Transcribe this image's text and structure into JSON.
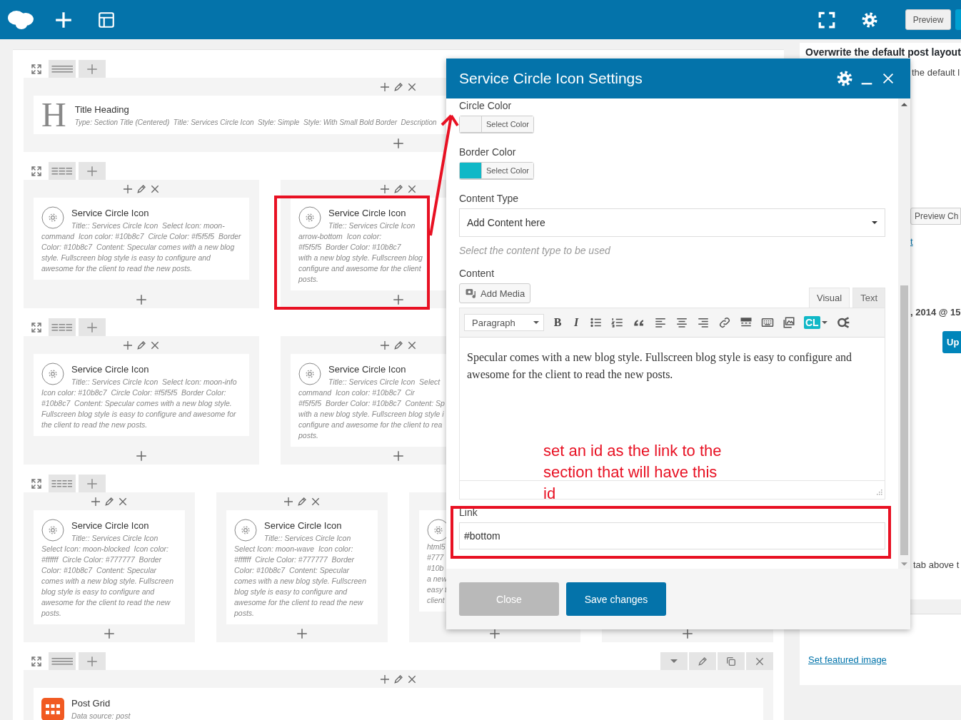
{
  "top_bar": {
    "preview_button": "Preview"
  },
  "builder": {
    "rows": [
      {
        "kind": "full",
        "columns": [
          {
            "elements": [
              {
                "kind": "heading",
                "icon_letter": "H",
                "title": "Title Heading",
                "description": "Type: Section Title (Centered)  Title: Services Circle Icon  Style: Simple  Style: With Small Bold Border  Description"
              }
            ]
          }
        ]
      },
      {
        "kind": "thirds",
        "columns": [
          {
            "elements": [
              {
                "kind": "service",
                "title": "Service Circle Icon",
                "description": "Title:: Services Circle Icon  Select Icon: moon-command  Icon color: #10b8c7  Circle Color: #f5f5f5  Border Color: #10b8c7  Content: Specular comes with a new blog style. Fullscreen blog style is easy to configure and awesome for the client to read the new posts."
              }
            ]
          },
          {
            "elements": [
              {
                "kind": "service",
                "title": "Service Circle Icon",
                "description": "Title:: Services Circle Icon\narrow-bottom  Icon color:\n#f5f5f5  Border Color: #10b8c7\nwith a new blog style. Fullscreen blog\nconfigure and awesome for the client\nposts."
              }
            ]
          }
        ]
      },
      {
        "kind": "thirds",
        "columns": [
          {
            "elements": [
              {
                "kind": "service",
                "title": "Service Circle Icon",
                "description": "Title:: Services Circle Icon  Select Icon: moon-info  Icon color: #10b8c7  Circle Color: #f5f5f5  Border Color: #10b8c7  Content: Specular comes with a new blog style. Fullscreen blog style is easy to configure and awesome for the client to read the new posts."
              }
            ]
          },
          {
            "elements": [
              {
                "kind": "service",
                "title": "Service Circle Icon",
                "description": "Title:: Services Circle Icon  Select\ncommand  Icon color: #10b8c7  Cir\n#f5f5f5  Border Color: #10b8c7  Content: Sp\nwith a new blog style. Fullscreen blog style i\nconfigure and awesome for the client to rea\nposts."
              }
            ]
          }
        ]
      },
      {
        "kind": "quarters",
        "columns": [
          {
            "elements": [
              {
                "kind": "service",
                "title": "Service Circle Icon",
                "description": "Title:: Services Circle Icon  Select Icon: moon-blocked  Icon color: #ffffff  Circle Color: #777777  Border Color: #10b8c7  Content: Specular comes with a new blog style. Fullscreen blog style is easy to configure and awesome for the client to read the new posts."
              }
            ]
          },
          {
            "elements": [
              {
                "kind": "service",
                "title": "Service Circle Icon",
                "description": "Title:: Services Circle Icon  Select Icon: moon-wave  Icon color: #ffffff  Circle Color: #777777  Border Color: #10b8c7  Content: Specular comes with a new blog style. Fullscreen blog style is easy to configure and awesome for the client to read the new posts."
              }
            ]
          },
          {
            "elements": [
              {
                "kind": "service",
                "description": "html5\n#777\n#10b\na new\neasy t\nclient"
              }
            ]
          },
          {}
        ]
      },
      {
        "kind": "full",
        "columns": [
          {
            "elements": [
              {
                "kind": "grid",
                "title": "Post Grid",
                "description": "Data source: post"
              }
            ]
          }
        ]
      }
    ]
  },
  "sidebar": {
    "items": [
      {
        "kind": "heading",
        "text": "Overwrite the default post layout"
      },
      {
        "kind": "text",
        "text": "the default l"
      },
      {
        "kind": "button",
        "text": "Preview Ch"
      },
      {
        "kind": "link",
        "text": "t"
      },
      {
        "kind": "meta",
        "text": ", 2014 @ 15"
      },
      {
        "kind": "primary",
        "text": "Up"
      },
      {
        "kind": "text",
        "text": "tab above t"
      }
    ],
    "featured_link": "Set featured image"
  },
  "modal": {
    "title": "Service Circle Icon Settings",
    "fields": [
      {
        "kind": "color",
        "label": "Circle Color",
        "color": "#f5f5f5",
        "button": "Select Color"
      },
      {
        "kind": "color",
        "label": "Border Color",
        "color": "#10b8c7",
        "button": "Select Color"
      },
      {
        "kind": "select",
        "label": "Content Type",
        "value": "Add Content here",
        "help": "Select the content type to be used"
      },
      {
        "kind": "editor",
        "label": "Content",
        "media_button": "Add Media",
        "tabs": [
          {
            "label": "Visual",
            "selected": true
          },
          {
            "label": "Text",
            "selected": false
          }
        ],
        "format": "Paragraph",
        "bold": "B",
        "italic": "I",
        "plugin": "CL",
        "text": "Specular comes with a new blog style. Fullscreen blog style is easy to configure and awesome for the client to read the new posts."
      },
      {
        "kind": "text",
        "label": "Link",
        "value": "#bottom"
      }
    ],
    "buttons": [
      {
        "label": "Close",
        "kind": "secondary"
      },
      {
        "label": "Save changes",
        "kind": "primary"
      }
    ]
  },
  "annotation": {
    "note": "set an id as the link to the section that will have this id"
  }
}
